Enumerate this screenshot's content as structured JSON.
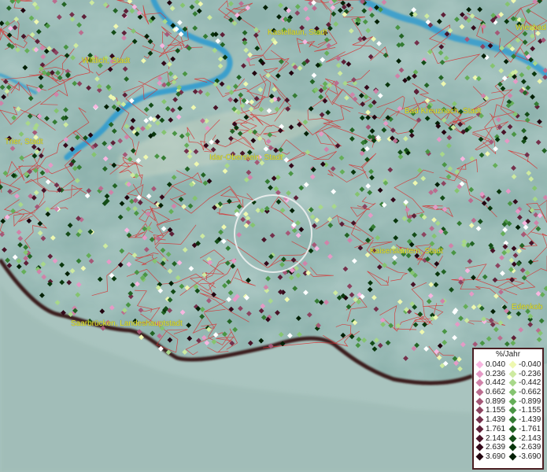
{
  "map": {
    "colors": {
      "background": "#8fb3ae",
      "water": "#2a9ad0",
      "boundary": "#d83030",
      "border": "#3a1a1a"
    },
    "cities": [
      {
        "name": "Kastellaun, Stadt"
      },
      {
        "name": "Wiesbad"
      },
      {
        "name": "Wittlich, Stadt"
      },
      {
        "name": "Bad Kreuznach, Stadt"
      },
      {
        "name": "Trier, Stadt"
      },
      {
        "name": "Idar-Oberstein, Stadt"
      },
      {
        "name": "Kaiserslautern, Stadt"
      },
      {
        "name": "Edenkob"
      },
      {
        "name": "Saarbrücken, Landeshauptstadt"
      }
    ]
  },
  "legend": {
    "title": "%/Jahr",
    "positive": [
      {
        "value": "0.040",
        "color": "#f7b6e0"
      },
      {
        "value": "0.236",
        "color": "#e59ac6"
      },
      {
        "value": "0.442",
        "color": "#d083a9"
      },
      {
        "value": "0.662",
        "color": "#bb6d8f"
      },
      {
        "value": "0.899",
        "color": "#a55877"
      },
      {
        "value": "1.155",
        "color": "#8c4460"
      },
      {
        "value": "1.439",
        "color": "#74304b"
      },
      {
        "value": "1.761",
        "color": "#5e2038"
      },
      {
        "value": "2.143",
        "color": "#491428"
      },
      {
        "value": "2.639",
        "color": "#34091a"
      },
      {
        "value": "3.690",
        "color": "#22030f"
      }
    ],
    "negative": [
      {
        "value": "-0.040",
        "color": "#eef8b0"
      },
      {
        "value": "-0.236",
        "color": "#cdeaa0"
      },
      {
        "value": "-0.442",
        "color": "#a8d88a"
      },
      {
        "value": "-0.662",
        "color": "#85c470"
      },
      {
        "value": "-0.899",
        "color": "#65ae58"
      },
      {
        "value": "-1.155",
        "color": "#4a9544"
      },
      {
        "value": "-1.439",
        "color": "#347c33"
      },
      {
        "value": "-1.761",
        "color": "#236424"
      },
      {
        "value": "-2.143",
        "color": "#144c17"
      },
      {
        "value": "-2.639",
        "color": "#09360c"
      },
      {
        "value": "-3.690",
        "color": "#032005"
      }
    ],
    "neutral_color": "#ffffff"
  }
}
